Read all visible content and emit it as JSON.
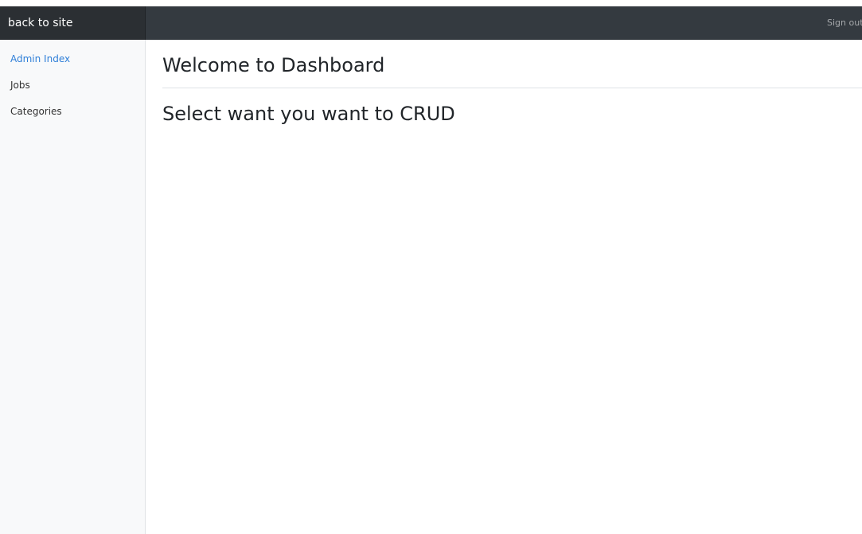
{
  "navbar": {
    "brand_label": "back to site",
    "signout_label": "Sign out"
  },
  "sidebar": {
    "items": [
      {
        "label": "Admin Index",
        "active": true
      },
      {
        "label": "Jobs",
        "active": false
      },
      {
        "label": "Categories",
        "active": false
      }
    ]
  },
  "main": {
    "title": "Welcome to Dashboard",
    "subtitle": "Select want you want to CRUD"
  },
  "colors": {
    "navbar_bg": "#343a40",
    "brand_bg": "#2b2f33",
    "active_link": "#2f7fd8",
    "sidebar_bg": "#f8f9fa"
  }
}
